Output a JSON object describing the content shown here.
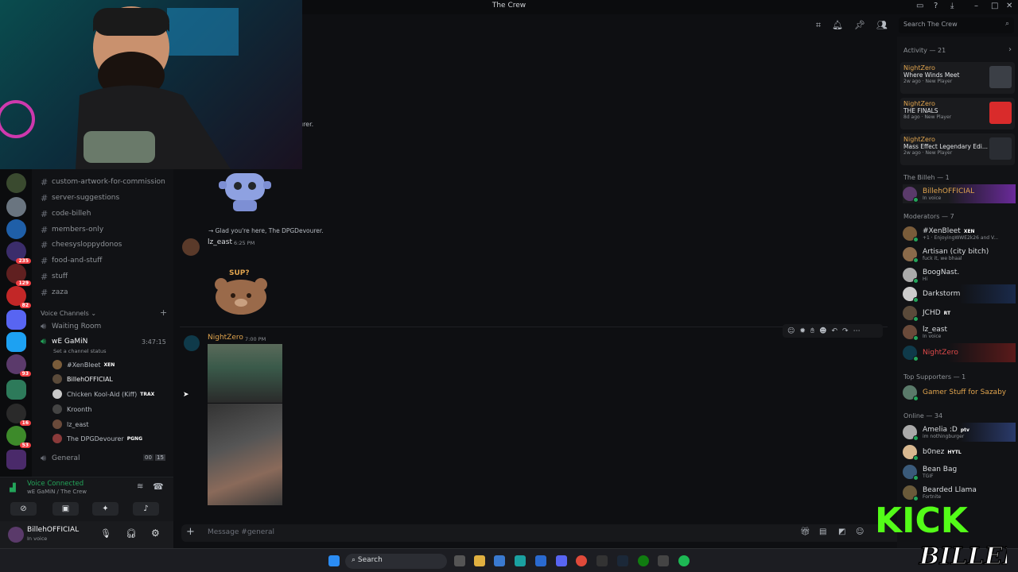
{
  "window": {
    "title": "The Crew"
  },
  "header": {
    "search_placeholder": "Search The Crew"
  },
  "server_badges": [
    "235",
    "129",
    "82",
    "93",
    "16",
    "53"
  ],
  "channels": [
    {
      "name": "custom-artwork-for-commission"
    },
    {
      "name": "server-suggestions"
    },
    {
      "name": "code-billeh"
    },
    {
      "name": "members-only"
    },
    {
      "name": "cheesysloppydonos"
    },
    {
      "name": "food-and-stuff"
    },
    {
      "name": "stuff"
    },
    {
      "name": "zaza"
    }
  ],
  "voice_section": {
    "label": "Voice Channels",
    "waiting_room": "Waiting Room",
    "active_channel": "wE GaMiN",
    "timer": "3:47:15",
    "status_placeholder": "Set a channel status",
    "members": [
      {
        "name": "#XenBleet",
        "tag": "XEN"
      },
      {
        "name": "BillehOFFICIAL",
        "tag": ""
      },
      {
        "name": "Chicken Kool-Aid (Kiff)",
        "tag": "TRAX"
      },
      {
        "name": "Kroonth",
        "tag": ""
      },
      {
        "name": "lz_east",
        "tag": ""
      },
      {
        "name": "The DPGDevourer",
        "tag": "PGNG"
      }
    ],
    "general": "General",
    "general_count_a": "00",
    "general_count_b": "15"
  },
  "voice_panel": {
    "status": "Voice Connected",
    "location": "wE GaMiN / The Crew"
  },
  "user_panel": {
    "name": "BillehOFFICIAL",
    "status": "In voice"
  },
  "messages": {
    "fragment": "urer.",
    "reply_text": "Glad you're here, The DPGDevourer.",
    "lz_author": "lz_east",
    "lz_time": "6:25 PM",
    "sticker_text": "SUP?",
    "nz_author": "NightZero",
    "nz_time": "7:00 PM"
  },
  "composer": {
    "placeholder": "Message #general"
  },
  "members_panel": {
    "activity_header": "Activity — 21",
    "activities": [
      {
        "who": "NightZero",
        "game": "Where Winds Meet",
        "when": "2w ago",
        "note": "New Player",
        "art": "#3b3f46"
      },
      {
        "who": "NightZero",
        "game": "THE FINALS",
        "when": "8d ago",
        "note": "New Player",
        "art": "#d92b2b"
      },
      {
        "who": "NightZero",
        "game": "Mass Effect Legendary Edi...",
        "when": "2w ago",
        "note": "New Player",
        "art": "#2a2d33"
      }
    ],
    "billeh_header": "The Billeh — 1",
    "billeh": {
      "name": "BillehOFFICIAL",
      "sub": "In voice"
    },
    "mods_header": "Moderators — 7",
    "mods": [
      {
        "name": "#XenBleet",
        "sub": "+1 · EnjoyingWWE2k26 and V...",
        "tag": "XEN"
      },
      {
        "name": "Artisan (city bitch)",
        "sub": "fuck it, we bhaal",
        "tag": ""
      },
      {
        "name": "BoogNast.",
        "sub": "Hi",
        "tag": ""
      },
      {
        "name": "Darkstorm",
        "sub": "",
        "tag": ""
      },
      {
        "name": "JCHD",
        "sub": "",
        "tag": "RT"
      },
      {
        "name": "lz_east",
        "sub": "In voice",
        "tag": ""
      },
      {
        "name": "NightZero",
        "sub": "",
        "tag": ""
      }
    ],
    "supporters_header": "Top Supporters — 1",
    "supporter": {
      "name": "Gamer Stuff for Sazaby"
    },
    "online_header": "Online — 34",
    "online": [
      {
        "name": "Amelia :D",
        "sub": "im nothingburger",
        "tag": "ptv"
      },
      {
        "name": "b0nez",
        "sub": "",
        "tag": "HYTL"
      },
      {
        "name": "Bean Bag",
        "sub": "TGIF",
        "tag": ""
      },
      {
        "name": "Bearded Llama",
        "sub": "Fortnite",
        "tag": ""
      }
    ]
  },
  "taskbar": {
    "search": "Search"
  },
  "overlay": {
    "kick_top": "KICK",
    "kick_bottom": "BILLEH"
  },
  "colors": {
    "accent": "#5865f2",
    "online": "#23a55a",
    "badge": "#f23f43",
    "kick_green": "#53fc18"
  }
}
